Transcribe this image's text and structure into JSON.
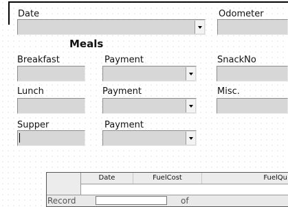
{
  "header": {
    "date_label": "Date",
    "odometer_label": "Odometer"
  },
  "meals": {
    "heading": "Meals",
    "breakfast_label": "Breakfast",
    "lunch_label": "Lunch",
    "supper_label": "Supper",
    "payment_label": "Payment",
    "snackno_label": "SnackNo",
    "misc_label": "Misc."
  },
  "grid": {
    "columns": [
      "Date",
      "FuelCost",
      "FuelQu"
    ],
    "record_label": "Record",
    "of_label": "of"
  },
  "icons": {
    "dropdown": "chevron-down-icon"
  }
}
